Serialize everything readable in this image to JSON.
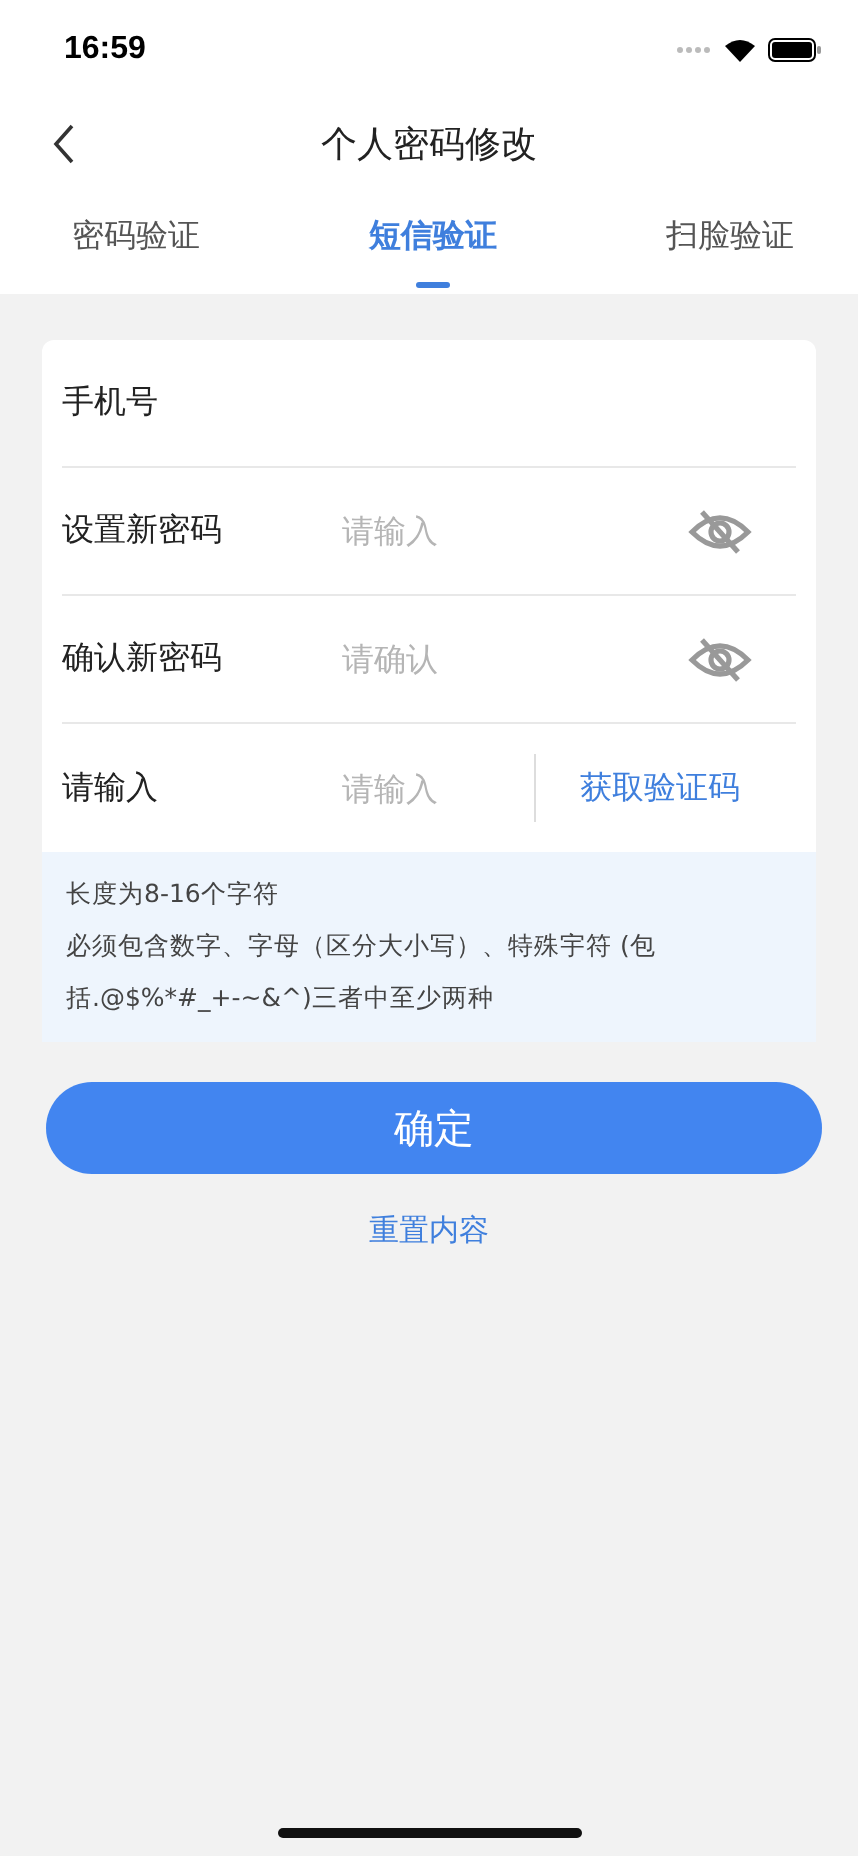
{
  "status_bar": {
    "time": "16:59"
  },
  "nav": {
    "title": "个人密码修改"
  },
  "tabs": [
    {
      "label": "密码验证",
      "selected": false
    },
    {
      "label": "短信验证",
      "selected": true
    },
    {
      "label": "扫脸验证",
      "selected": false
    }
  ],
  "form": [
    {
      "kind": "plain",
      "label": "手机号"
    },
    {
      "kind": "password",
      "label": "设置新密码",
      "placeholder": "请输入"
    },
    {
      "kind": "password",
      "label": "确认新密码",
      "placeholder": "请确认"
    },
    {
      "kind": "code",
      "label": "请输入",
      "placeholder": "请输入",
      "action": "获取验证码"
    }
  ],
  "hint_lines": [
    "长度为8-16个字符",
    "必须包含数字、字母（区分大小写）、特殊宇符 (包",
    "括.@$%*#_+-~&^)三者中至少两种"
  ],
  "submit": "确定",
  "reset": "重置内容"
}
